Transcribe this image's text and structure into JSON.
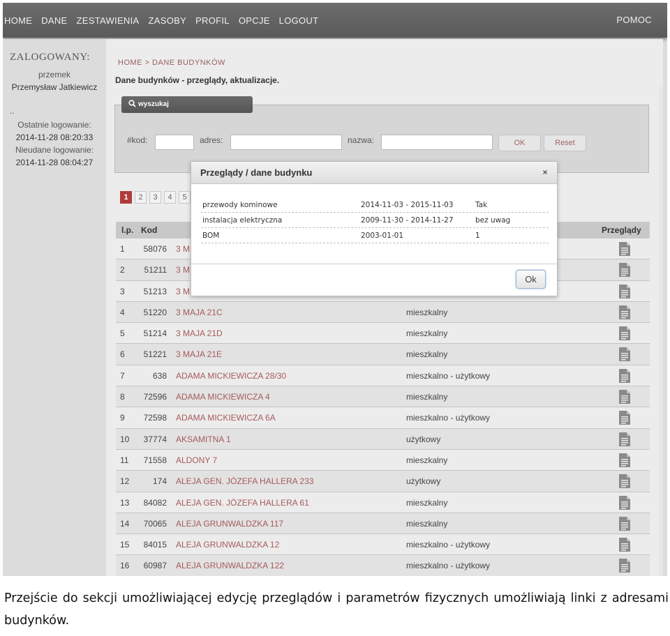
{
  "nav": {
    "items": [
      "HOME",
      "DANE",
      "ZESTAWIENIA",
      "ZASOBY",
      "PROFIL",
      "OPCJE",
      "LOGOUT"
    ],
    "help": "POMOC"
  },
  "sidebar": {
    "header": "ZALOGOWANY:",
    "username": "przemek",
    "fullname": "Przemysław Jatkiewicz",
    "dots": "..",
    "last_login_label": "Ostatnie logowanie:",
    "last_login": "2014-11-28 08:20:33",
    "failed_login_label": "Nieudane logowanie:",
    "failed_login": "2014-11-28 08:04:27"
  },
  "main": {
    "breadcrumb": "HOME > DANE BUDYNKÓW",
    "title": "Dane budynków - przeglądy, aktualizacje."
  },
  "search": {
    "tab_label": "wyszukaj",
    "kod_label": "#kod:",
    "adres_label": "adres:",
    "nazwa_label": "nazwa:",
    "ok_label": "OK",
    "reset_label": "Reset",
    "kod_value": "",
    "adres_value": "",
    "nazwa_value": ""
  },
  "pagination": {
    "pages": [
      "1",
      "2",
      "3",
      "4",
      "5"
    ],
    "active": "1"
  },
  "table": {
    "headers": {
      "lp": "l.p.",
      "kod": "Kod",
      "przeglady": "Przeglądy"
    },
    "rows": [
      {
        "lp": "1",
        "kod": "58076",
        "adres": "3 M",
        "typ": ""
      },
      {
        "lp": "2",
        "kod": "51211",
        "adres": "3 M",
        "typ": ""
      },
      {
        "lp": "3",
        "kod": "51213",
        "adres": "3 M",
        "typ": ""
      },
      {
        "lp": "4",
        "kod": "51220",
        "adres": "3 MAJA 21C",
        "typ": "mieszkalny"
      },
      {
        "lp": "5",
        "kod": "51214",
        "adres": "3 MAJA 21D",
        "typ": "mieszkalny"
      },
      {
        "lp": "6",
        "kod": "51221",
        "adres": "3 MAJA 21E",
        "typ": "mieszkalny"
      },
      {
        "lp": "7",
        "kod": "638",
        "adres": "ADAMA MICKIEWICZA 28/30",
        "typ": "mieszkalno - użytkowy"
      },
      {
        "lp": "8",
        "kod": "72596",
        "adres": "ADAMA MICKIEWICZA 4",
        "typ": "mieszkalny"
      },
      {
        "lp": "9",
        "kod": "72598",
        "adres": "ADAMA MICKIEWICZA 6A",
        "typ": "mieszkalno - użytkowy"
      },
      {
        "lp": "10",
        "kod": "37774",
        "adres": "AKSAMITNA 1",
        "typ": "użytkowy"
      },
      {
        "lp": "11",
        "kod": "71558",
        "adres": "ALDONY 7",
        "typ": "mieszkalny"
      },
      {
        "lp": "12",
        "kod": "174",
        "adres": "ALEJA GEN. JÓZEFA HALLERA 233",
        "typ": "użytkowy"
      },
      {
        "lp": "13",
        "kod": "84082",
        "adres": "ALEJA GEN. JÓZEFA HALLERA 61",
        "typ": "mieszkalny"
      },
      {
        "lp": "14",
        "kod": "70065",
        "adres": "ALEJA GRUNWALDZKA 117",
        "typ": "mieszkalny"
      },
      {
        "lp": "15",
        "kod": "84015",
        "adres": "ALEJA GRUNWALDZKA 12",
        "typ": "mieszkalno - użytkowy"
      },
      {
        "lp": "16",
        "kod": "60987",
        "adres": "ALEJA GRUNWALDZKA 122",
        "typ": "mieszkalno - użytkowy"
      }
    ]
  },
  "modal": {
    "title": "Przeglądy / dane budynku",
    "close": "×",
    "rows": [
      {
        "name": "przewody kominowe",
        "period": "2014-11-03 - 2015-11-03",
        "result": "Tak"
      },
      {
        "name": "instalacja elektryczna",
        "period": "2009-11-30 - 2014-11-27",
        "result": "bez uwag"
      },
      {
        "name": "BOM",
        "period": "2003-01-01",
        "result": "1"
      }
    ],
    "ok_label": "Ok"
  },
  "caption": "Przejście do sekcji umożliwiającej edycję przeglądów i parametrów fizycznych umożliwiają linki z adresami budynków.",
  "colors": {
    "nav_bg": "#5f5f5f",
    "link": "#a65a5a",
    "active_page": "#b03b3b"
  }
}
